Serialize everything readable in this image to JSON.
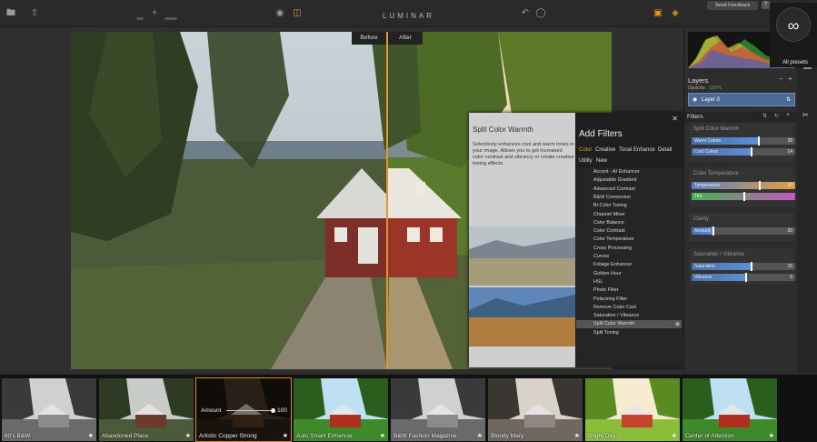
{
  "app": {
    "brand": "LUMINAR"
  },
  "toolbar": {
    "feedback_label": "Send Feedback",
    "help_label": "?",
    "before_label": "Before",
    "after_label": "After"
  },
  "popover": {
    "info_title": "Split Color Warmth",
    "info_desc": "Selectively enhances cool and warm tones in your image. Allows you to get increased color contrast and vibrancy or create creative toning effects.",
    "title": "Add Filters",
    "categories": [
      "Color",
      "Creative",
      "Tonal Enhance",
      "Detail",
      "Utility",
      "New"
    ],
    "active_category": "Color",
    "filters": [
      "Accent - AI Enhancer",
      "Adjustable Gradient",
      "Advanced Contrast",
      "B&W Conversion",
      "Bi-Color Toning",
      "Channel Mixer",
      "Color Balance",
      "Color Contrast",
      "Color Temperature",
      "Cross Processing",
      "Curves",
      "Foliage Enhancer",
      "Golden Hour",
      "HSL",
      "Photo Filter",
      "Polarizing Filter",
      "Remove Color Cast",
      "Saturation / Vibrance",
      "Split Color Warmth",
      "Split Toning"
    ],
    "highlighted_filter_index": 18
  },
  "layers": {
    "title": "Layers",
    "opacity_label": "Opacity:",
    "opacity_value": "100%",
    "layer_name": "Layer 0"
  },
  "filters_panel": {
    "title": "Filters",
    "groups": [
      {
        "title": "Split Color Warmth",
        "sliders": [
          {
            "label": "Warm Colors",
            "value": "28"
          },
          {
            "label": "Cool Colors",
            "value": "14"
          }
        ]
      },
      {
        "title": "Color Temperature",
        "sliders": [
          {
            "label": "Temperature",
            "value": "30"
          },
          {
            "label": "Tint",
            "value": ""
          }
        ]
      },
      {
        "title": "Clarity",
        "sliders": [
          {
            "label": "Amount",
            "value": "20"
          }
        ]
      },
      {
        "title": "Saturation / Vibrance",
        "sliders": [
          {
            "label": "Saturation",
            "value": "15"
          },
          {
            "label": "Vibrance",
            "value": "5"
          }
        ]
      }
    ]
  },
  "presets": [
    {
      "name": "60's B&W",
      "style": "bw"
    },
    {
      "name": "Abandoned Place",
      "style": "muted"
    },
    {
      "name": "Artistic Copper Strong",
      "style": "dark",
      "active": true,
      "amount_label": "Amount",
      "amount_value": "100"
    },
    {
      "name": "Auto Smart Enhancer",
      "style": "vivid"
    },
    {
      "name": "B&W Fashion Magazine",
      "style": "bw"
    },
    {
      "name": "Bloody Mary",
      "style": "bwwarm"
    },
    {
      "name": "Bright Day",
      "style": "bright"
    },
    {
      "name": "Center of Attention",
      "style": "vivid"
    }
  ],
  "all_presets_label": "All presets",
  "colors": {
    "accent": "#e8932a",
    "layer_selected": "#4b6b94"
  }
}
